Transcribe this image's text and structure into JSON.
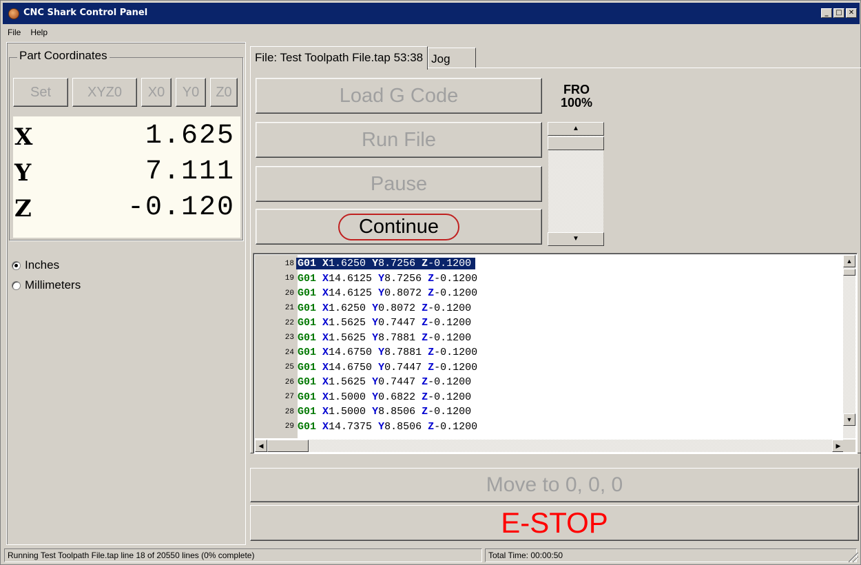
{
  "window": {
    "title": "CNC Shark Control Panel",
    "minimize": "_",
    "maximize": "□",
    "close": "✕"
  },
  "menu": {
    "file": "File",
    "help": "Help"
  },
  "part_coordinates": {
    "label": "Part Coordinates",
    "buttons": {
      "set": "Set",
      "xyz0": "XYZ0",
      "x0": "X0",
      "y0": "Y0",
      "z0": "Z0"
    },
    "x": {
      "axis": "X",
      "value": "1.625"
    },
    "y": {
      "axis": "Y",
      "value": "7.111"
    },
    "z": {
      "axis": "Z",
      "value": "-0.120"
    }
  },
  "units": {
    "inches": "Inches",
    "millimeters": "Millimeters",
    "selected": "inches"
  },
  "tabs": {
    "file": "File: Test Toolpath File.tap 53:38",
    "jog": "Jog"
  },
  "controls": {
    "load_gcode": "Load G Code",
    "run_file": "Run File",
    "pause": "Pause",
    "continue": "Continue"
  },
  "fro": {
    "label": "FRO",
    "value": "100%"
  },
  "gcode": {
    "selected_line": 18,
    "lines": [
      {
        "n": "18",
        "g": "G01",
        "x": "1.6250",
        "yk": "Y",
        "y": "8.7256",
        "z": "-0.1200"
      },
      {
        "n": "19",
        "g": "G01",
        "x": "14.6125",
        "yk": "Y",
        "y": "8.7256",
        "z": "-0.1200"
      },
      {
        "n": "20",
        "g": "G01",
        "x": "14.6125",
        "yk": "Y",
        "y": "0.8072",
        "z": "-0.1200"
      },
      {
        "n": "21",
        "g": "G01",
        "x": "1.6250",
        "yk": "Y",
        "y": "0.8072",
        "z": "-0.1200"
      },
      {
        "n": "22",
        "g": "G01",
        "x": "1.5625",
        "yk": "Y",
        "y": "0.7447",
        "z": "-0.1200"
      },
      {
        "n": "23",
        "g": "G01",
        "x": "1.5625",
        "yk": "Y",
        "y": "8.7881",
        "z": "-0.1200"
      },
      {
        "n": "24",
        "g": "G01",
        "x": "14.6750",
        "yk": "Y",
        "y": "8.7881",
        "z": "-0.1200"
      },
      {
        "n": "25",
        "g": "G01",
        "x": "14.6750",
        "yk": "Y",
        "y": "0.7447",
        "z": "-0.1200"
      },
      {
        "n": "26",
        "g": "G01",
        "x": "1.5625",
        "yk": "Y",
        "y": "0.7447",
        "z": "-0.1200"
      },
      {
        "n": "27",
        "g": "G01",
        "x": "1.5000",
        "yk": "Y",
        "y": "0.6822",
        "z": "-0.1200"
      },
      {
        "n": "28",
        "g": "G01",
        "x": "1.5000",
        "yk": "Y",
        "y": "8.8506",
        "z": "-0.1200"
      },
      {
        "n": "29",
        "g": "G01",
        "x": "14.7375",
        "yk": "Y",
        "y": "8.8506",
        "z": "-0.1200"
      }
    ]
  },
  "actions": {
    "move_to_zero": "Move to 0, 0, 0",
    "estop": "E-STOP"
  },
  "status": {
    "message": "Running Test Toolpath File.tap line 18 of 20550 lines (0% complete)",
    "total_time": "Total Time: 00:00:50"
  },
  "colors": {
    "titlebar": "#0a246a",
    "estop": "#ff0000",
    "gcode_g": "#007800",
    "gcode_axis": "#0000d0",
    "continue_ring": "#c02020"
  }
}
